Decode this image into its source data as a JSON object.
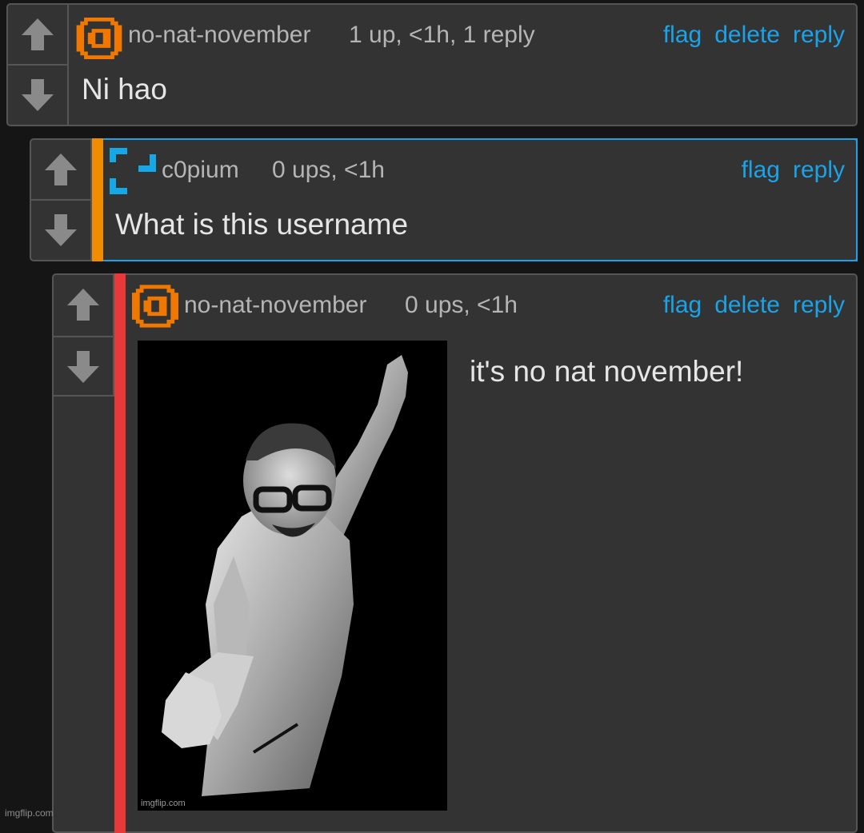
{
  "comments": [
    {
      "username": "no-nat-november",
      "meta": "1 up, <1h, 1 reply",
      "actions": [
        "flag",
        "delete",
        "reply"
      ],
      "body": "Ni hao",
      "stripe_color": null,
      "avatar": "orange-pixel-avatar-icon"
    },
    {
      "username": "c0pium",
      "meta": "0 ups, <1h",
      "actions": [
        "flag",
        "reply"
      ],
      "body": "What is this username",
      "stripe_color": "#f08c00",
      "avatar": "blue-bracket-avatar-icon"
    },
    {
      "username": "no-nat-november",
      "meta": "0 ups, <1h",
      "actions": [
        "flag",
        "delete",
        "reply"
      ],
      "body": "it's no nat november!",
      "stripe_color": "#e8383a",
      "avatar": "orange-pixel-avatar-icon",
      "image": {
        "description_icon": "man-with-glasses-reaching-out-photo",
        "watermark": "imgflip.com"
      }
    }
  ],
  "footer_watermark": "imgflip.com",
  "colors": {
    "background": "#151515",
    "panel": "#333333",
    "border": "#555555",
    "link": "#1aa3e8",
    "text": "#e6e6e6",
    "muted": "#b5b5b5",
    "avatar_orange": "#f07800",
    "avatar_blue": "#14a8e6",
    "highlight_border": "#1aa3e8"
  }
}
